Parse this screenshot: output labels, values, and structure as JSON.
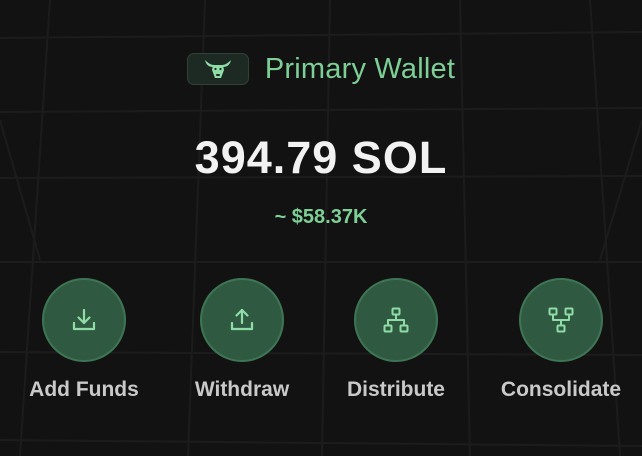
{
  "wallet": {
    "name": "Primary Wallet",
    "logo_icon": "bull-head-icon",
    "balance": "394.79 SOL",
    "fiat_estimate": "~ $58.37K"
  },
  "actions": [
    {
      "label": "Add Funds",
      "icon": "download-tray-icon"
    },
    {
      "label": "Withdraw",
      "icon": "upload-tray-icon"
    },
    {
      "label": "Distribute",
      "icon": "hierarchy-icon"
    },
    {
      "label": "Consolidate",
      "icon": "merge-nodes-icon"
    }
  ],
  "colors": {
    "accent": "#7dcf96",
    "button_fill": "#2f5a41",
    "background": "#121212"
  }
}
